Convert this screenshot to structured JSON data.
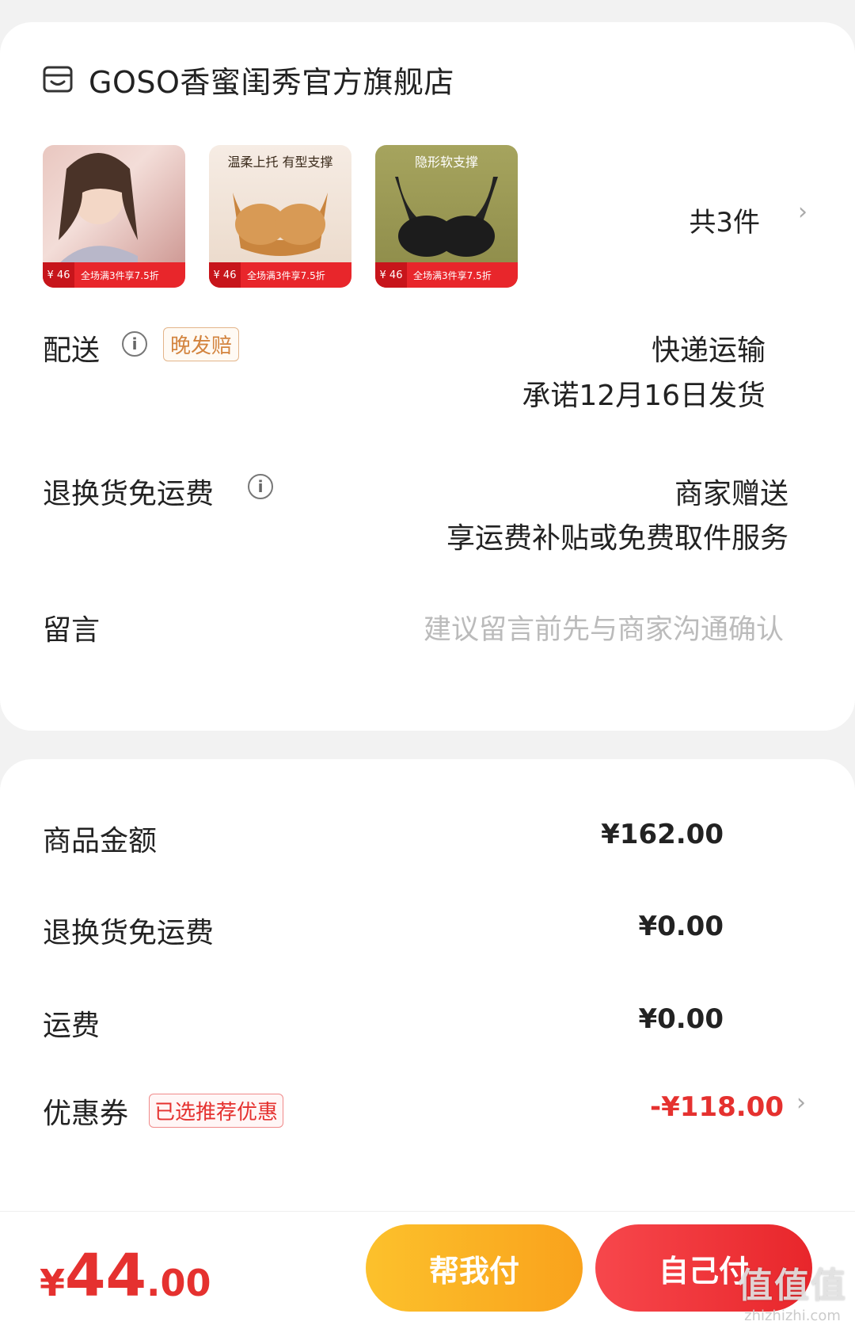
{
  "store": {
    "name": "GOSO香蜜闺秀官方旗舰店",
    "icon": "store-icon"
  },
  "products": {
    "items": [
      {
        "headline": "",
        "price": "¥ 46",
        "promo": "全场满3件享7.5折"
      },
      {
        "headline": "温柔上托 有型支撑",
        "price": "¥ 46",
        "promo": "全场满3件享7.5折"
      },
      {
        "headline": "隐形软支撑",
        "price": "¥ 46",
        "promo": "全场满3件享7.5折"
      }
    ],
    "count_label": "共3件"
  },
  "delivery": {
    "label": "配送",
    "tag": "晚发赔",
    "method": "快递运输",
    "promise": "承诺12月16日发货"
  },
  "return_shipping": {
    "label": "退换货免运费",
    "value": "商家赠送",
    "desc": "享运费补贴或免费取件服务"
  },
  "message": {
    "label": "留言",
    "placeholder": "建议留言前先与商家沟通确认"
  },
  "summary": {
    "goods_label": "商品金额",
    "goods_value": "¥162.00",
    "return_label": "退换货免运费",
    "return_value": "¥0.00",
    "freight_label": "运费",
    "freight_value": "¥0.00",
    "coupon_label": "优惠券",
    "coupon_tag": "已选推荐优惠",
    "coupon_value": "-¥118.00"
  },
  "footer": {
    "total_symbol": "¥",
    "total_int": "44",
    "total_dec": ".00",
    "help_pay": "帮我付",
    "self_pay": "自己付"
  },
  "watermark": {
    "big": "值值值",
    "small": "zhizhizhi.com"
  },
  "colors": {
    "accent_red": "#e5312f",
    "help_yellow": "#fbb424",
    "tag_orange": "#d3843f"
  }
}
